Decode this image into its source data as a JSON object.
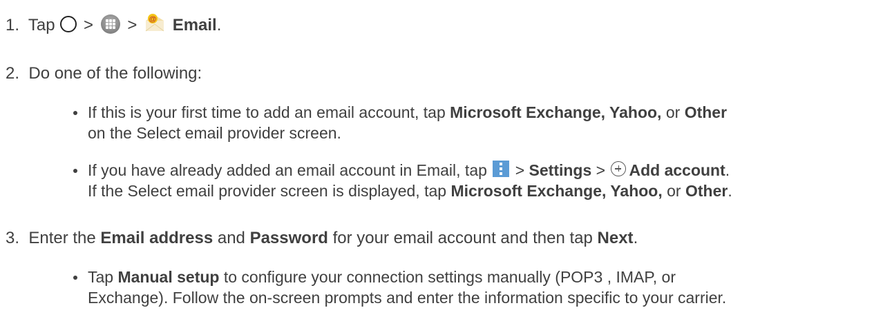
{
  "step1": {
    "number": "1.",
    "tap": "Tap",
    "sep1": ">",
    "sep2": ">",
    "email_label": "Email",
    "period": ".",
    "icons": [
      "home-icon",
      "apps-icon",
      "email-app-icon"
    ]
  },
  "step2": {
    "number": "2.",
    "text": "Do one of the following:",
    "bullet1": {
      "line1_pre": "If this is your first time to add an email account, tap ",
      "opt1": "Microsoft Exchange, Yahoo,",
      "or": " or ",
      "opt2": "Other",
      "line2": "on the Select email provider screen."
    },
    "bullet2": {
      "line1_pre": "If you have already added an email account in Email, tap ",
      "sep1": " > ",
      "settings": "Settings",
      "sep2": " > ",
      "add_account": "Add account",
      "period1": ".",
      "line2_pre": "If the Select email provider screen is displayed, tap ",
      "opt1": "Microsoft Exchange, Yahoo,",
      "or": " or ",
      "opt2": "Other",
      "period2": ".",
      "icons": [
        "menu-icon",
        "add-icon"
      ]
    }
  },
  "step3": {
    "number": "3.",
    "pre": "Enter the ",
    "email_address": "Email address",
    "and": " and ",
    "password": "Password",
    "mid": " for your email account and then tap ",
    "next": "Next",
    "period": ".",
    "bullet1": {
      "pre": "Tap ",
      "manual_setup": "Manual setup",
      "line1_post": " to configure your connection settings manually (POP3 , IMAP, or",
      "line2": "Exchange). Follow the on-screen prompts and enter the information specific to your carrier."
    }
  }
}
